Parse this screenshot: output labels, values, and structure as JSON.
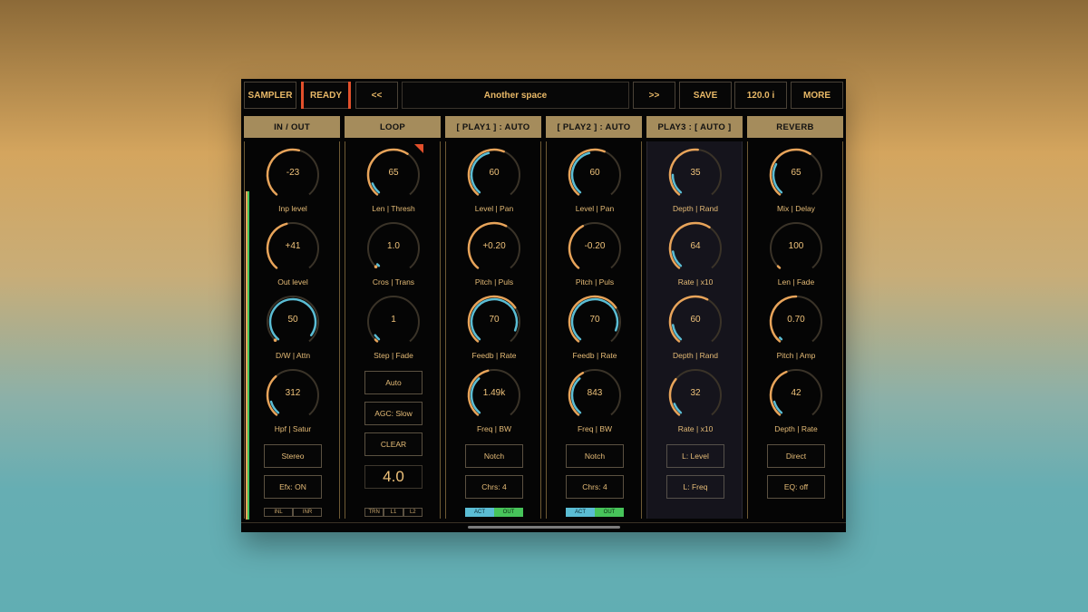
{
  "topbar": {
    "sampler": "SAMPLER",
    "ready": "READY",
    "prev": "<<",
    "preset_title": "Another space",
    "next": ">>",
    "save": "SAVE",
    "tempo": "120.0 i",
    "more": "MORE"
  },
  "colors": {
    "accent_orange": "#e8a45a",
    "accent_cyan": "#5bbdd4",
    "header_gold": "#a58c5c",
    "ready_red": "#e2502b",
    "meter_green": "#47c45a"
  },
  "columns": [
    {
      "title": "IN / OUT",
      "knobs": [
        {
          "value": "-23",
          "label": "Inp level",
          "orange": 0.55,
          "cyan": 0
        },
        {
          "value": "+41",
          "label": "Out level",
          "orange": 0.45,
          "cyan": 0
        },
        {
          "value": "50",
          "label": "D/W | Attn",
          "orange": 0,
          "cyan": 0.95
        },
        {
          "value": "312",
          "label": "Hpf | Satur",
          "orange": 0.35,
          "cyan": 0.12
        }
      ],
      "buttons": [
        "Stereo",
        "Efx: ON"
      ],
      "tabs": [
        "INL",
        "INR"
      ]
    },
    {
      "title": "LOOP",
      "knobs": [
        {
          "value": "65",
          "label": "Len | Thresh",
          "orange": 0.62,
          "cyan": 0.1
        },
        {
          "value": "1.0",
          "label": "Cros | Trans",
          "orange": 0,
          "cyan": 0.02
        },
        {
          "value": "1",
          "label": "Step | Fade",
          "orange": 0.02,
          "cyan": 0.05
        }
      ],
      "buttons": [
        "Auto",
        "AGC: Slow",
        "CLEAR"
      ],
      "bignum": "4.0",
      "tabs": [
        "TRN",
        "L1",
        "L2"
      ]
    },
    {
      "title": "[ PLAY1 ] : AUTO",
      "knobs": [
        {
          "value": "60",
          "label": "Level | Pan",
          "orange": 0.58,
          "cyan": 0.45
        },
        {
          "value": "+0.20",
          "label": "Pitch | Puls",
          "orange": 0.6,
          "cyan": 0
        },
        {
          "value": "70",
          "label": "Feedb | Rate",
          "orange": 0.7,
          "cyan": 0.9
        },
        {
          "value": "1.49k",
          "label": "Freq | BW",
          "orange": 0.45,
          "cyan": 0.35
        }
      ],
      "buttons": [
        "Notch",
        "Chrs: 4"
      ],
      "tabs": [
        "ACT",
        "OUT"
      ]
    },
    {
      "title": "[ PLAY2 ] : AUTO",
      "knobs": [
        {
          "value": "60",
          "label": "Level | Pan",
          "orange": 0.58,
          "cyan": 0.45
        },
        {
          "value": "-0.20",
          "label": "Pitch | Puls",
          "orange": 0.4,
          "cyan": 0
        },
        {
          "value": "70",
          "label": "Feedb | Rate",
          "orange": 0.7,
          "cyan": 0.9
        },
        {
          "value": "843",
          "label": "Freq | BW",
          "orange": 0.4,
          "cyan": 0.35
        }
      ],
      "buttons": [
        "Notch",
        "Chrs: 4"
      ],
      "tabs": [
        "ACT",
        "OUT"
      ]
    },
    {
      "title": "PLAY3 : [ AUTO ]",
      "knobs": [
        {
          "value": "35",
          "label": "Depth | Rand",
          "orange": 0.52,
          "cyan": 0.18
        },
        {
          "value": "64",
          "label": "Rate | x10",
          "orange": 0.62,
          "cyan": 0.15
        },
        {
          "value": "60",
          "label": "Depth | Rand",
          "orange": 0.6,
          "cyan": 0.15
        },
        {
          "value": "32",
          "label": "Rate | x10",
          "orange": 0.32,
          "cyan": 0.1
        }
      ],
      "buttons": [
        "L: Level",
        "L: Freq"
      ]
    },
    {
      "title": "REVERB",
      "knobs": [
        {
          "value": "65",
          "label": "Mix | Delay",
          "orange": 0.62,
          "cyan": 0.28
        },
        {
          "value": "100",
          "label": "Len | Fade",
          "orange": 0.02,
          "cyan": 0
        },
        {
          "value": "0.70",
          "label": "Pitch | Amp",
          "orange": 0.5,
          "cyan": 0.02
        },
        {
          "value": "42",
          "label": "Depth | Rate",
          "orange": 0.42,
          "cyan": 0.12
        }
      ],
      "buttons": [
        "Direct",
        "EQ: off"
      ]
    }
  ]
}
